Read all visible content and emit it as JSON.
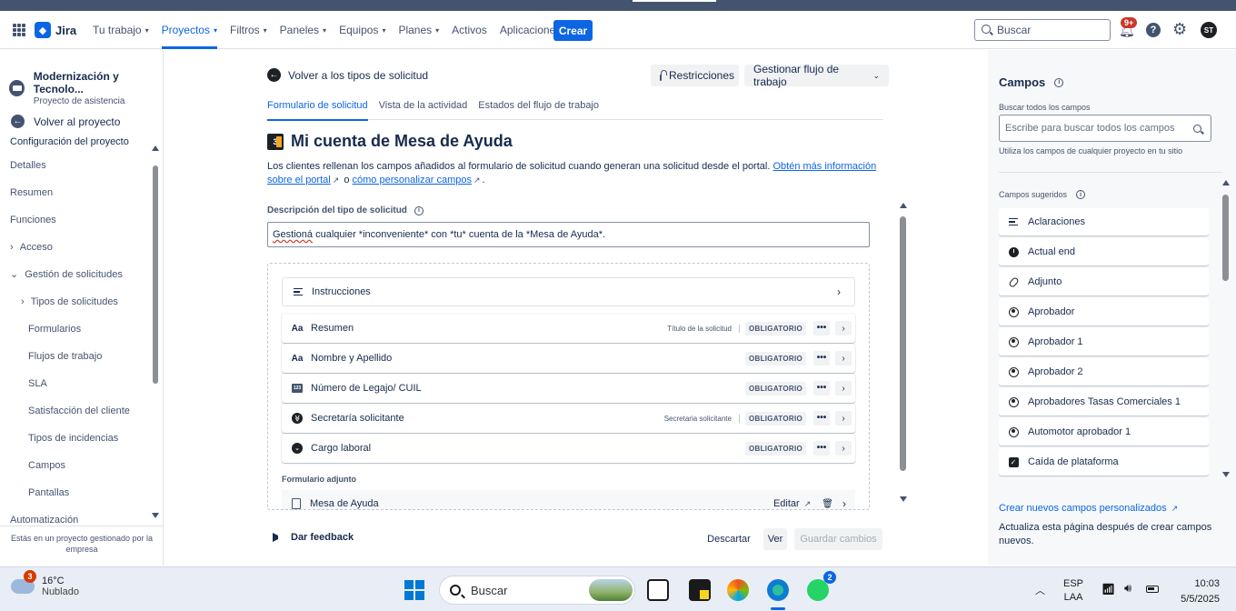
{
  "nav": {
    "logo": "Jira",
    "menu": [
      {
        "label": "Tu trabajo",
        "chevron": true,
        "active": false
      },
      {
        "label": "Proyectos",
        "chevron": true,
        "active": true
      },
      {
        "label": "Filtros",
        "chevron": true,
        "active": false
      },
      {
        "label": "Paneles",
        "chevron": true,
        "active": false
      },
      {
        "label": "Equipos",
        "chevron": true,
        "active": false
      },
      {
        "label": "Planes",
        "chevron": true,
        "active": false
      },
      {
        "label": "Activos",
        "chevron": false,
        "active": false
      },
      {
        "label": "Aplicaciones",
        "chevron": true,
        "active": false
      }
    ],
    "create_label": "Crear",
    "search_placeholder": "Buscar",
    "notifications_badge": "9+",
    "help_label": "?",
    "avatar_initials": "ST"
  },
  "sidebar": {
    "project_name": "Modernización y Tecnolo...",
    "project_type": "Proyecto de asistencia",
    "back_label": "Volver al proyecto",
    "section_title": "Configuración del proyecto",
    "items": [
      {
        "label": "Detalles",
        "indent": 0,
        "expander": ""
      },
      {
        "label": "Resumen",
        "indent": 0,
        "expander": ""
      },
      {
        "label": "Funciones",
        "indent": 0,
        "expander": ""
      },
      {
        "label": "Acceso",
        "indent": 0,
        "expander": "›"
      },
      {
        "label": "Gestión de solicitudes",
        "indent": 0,
        "expander": "⌄"
      },
      {
        "label": "Tipos de solicitudes",
        "indent": 1,
        "expander": "›"
      },
      {
        "label": "Formularios",
        "indent": 2,
        "expander": ""
      },
      {
        "label": "Flujos de trabajo",
        "indent": 2,
        "expander": ""
      },
      {
        "label": "SLA",
        "indent": 2,
        "expander": ""
      },
      {
        "label": "Satisfacción del cliente",
        "indent": 2,
        "expander": ""
      },
      {
        "label": "Tipos de incidencias",
        "indent": 2,
        "expander": ""
      },
      {
        "label": "Campos",
        "indent": 2,
        "expander": ""
      },
      {
        "label": "Pantallas",
        "indent": 2,
        "expander": ""
      },
      {
        "label": "Automatización",
        "indent": 0,
        "expander": ""
      }
    ],
    "footer": "Estás en un proyecto gestionado por la empresa"
  },
  "main": {
    "back_label": "Volver a los tipos de solicitud",
    "restrictions_label": "Restricciones",
    "workflow_label": "Gestionar flujo de trabajo",
    "tabs": [
      {
        "label": "Formulario de solicitud",
        "active": true
      },
      {
        "label": "Vista de la actividad",
        "active": false
      },
      {
        "label": "Estados del flujo de trabajo",
        "active": false
      }
    ],
    "title": "Mi cuenta de Mesa de Ayuda",
    "title_icon_text": "3",
    "description_text": "Los clientes rellenan los campos añadidos al formulario de solicitud cuando generan una solicitud desde el portal.",
    "description_link1": "Obtén más información sobre el portal",
    "description_mid": "o",
    "description_link2": "cómo personalizar campos",
    "field_label": "Descripción del tipo de solicitud",
    "field_value_word": "Gestioná",
    "field_value_rest": " cualquier *inconveniente* con *tu* cuenta de la *Mesa de Ayuda*.",
    "instructions_label": "Instrucciones",
    "required_label": "OBLIGATORIO",
    "fields": [
      {
        "label": "Resumen",
        "icon": "Aa",
        "hint": "Título de la solicitud"
      },
      {
        "label": "Nombre y Apellido",
        "icon": "Aa",
        "hint": ""
      },
      {
        "label": "Número de Legajo/ CUIL",
        "icon": "123",
        "hint": ""
      },
      {
        "label": "Secretaría solicitante",
        "icon": "chevrons",
        "hint": "Secretaria solicitante"
      },
      {
        "label": "Cargo laboral",
        "icon": "chevron",
        "hint": ""
      }
    ],
    "attached_form_title": "Formulario adjunto",
    "attached_form_name": "Mesa de Ayuda",
    "edit_label": "Editar",
    "feedback_label": "Dar feedback",
    "discard_label": "Descartar",
    "view_label": "Ver",
    "save_label": "Guardar cambios"
  },
  "rpanel": {
    "title": "Campos",
    "search_label": "Buscar todos los campos",
    "search_placeholder": "Escribe para buscar todos los campos",
    "search_hint": "Utiliza los campos de cualquier proyecto en tu sitio",
    "suggested_title": "Campos sugeridos",
    "suggested": [
      {
        "label": "Aclaraciones",
        "icon": "lines"
      },
      {
        "label": "Actual end",
        "icon": "clock"
      },
      {
        "label": "Adjunto",
        "icon": "clip"
      },
      {
        "label": "Aprobador",
        "icon": "user"
      },
      {
        "label": "Aprobador 1",
        "icon": "user"
      },
      {
        "label": "Aprobador 2",
        "icon": "user"
      },
      {
        "label": "Aprobadores Tasas Comerciales 1",
        "icon": "user"
      },
      {
        "label": "Automotor aprobador 1",
        "icon": "user"
      },
      {
        "label": "Caída de plataforma",
        "icon": "check"
      }
    ],
    "create_link": "Crear nuevos campos personalizados",
    "note": "Actualiza esta página después de crear campos nuevos."
  },
  "taskbar": {
    "weather_badge": "3",
    "temperature": "16°C",
    "condition": "Nublado",
    "search_label": "Buscar",
    "whatsapp_badge": "2",
    "lang_top": "ESP",
    "lang_bottom": "LAA",
    "time": "10:03",
    "date": "5/5/2025"
  }
}
